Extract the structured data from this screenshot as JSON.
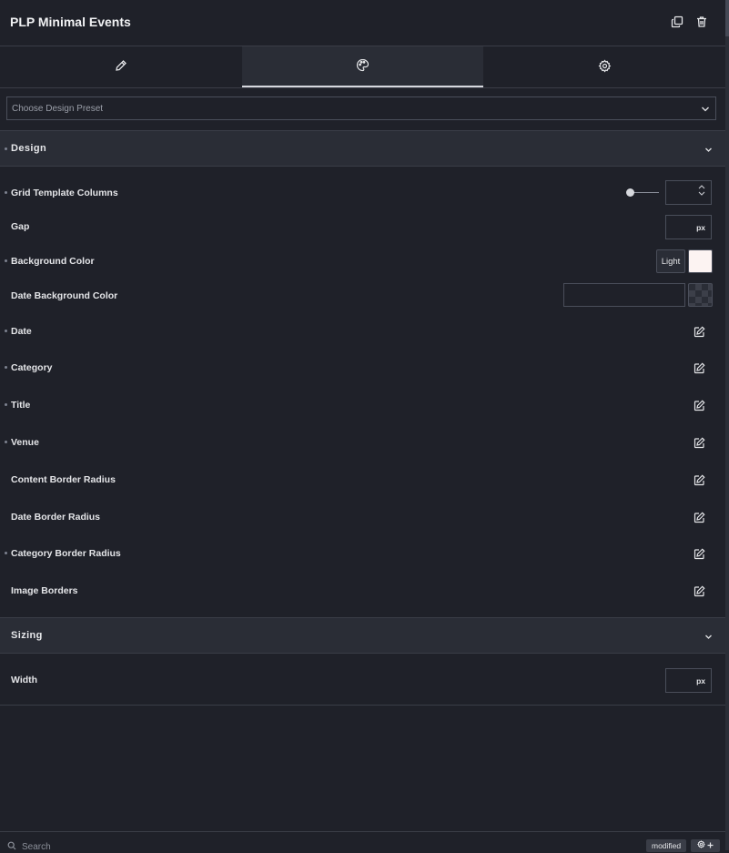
{
  "header": {
    "title": "PLP Minimal Events"
  },
  "tabs": [
    {
      "icon": "pencil-icon"
    },
    {
      "icon": "palette-icon"
    },
    {
      "icon": "gear-icon"
    }
  ],
  "preset": {
    "placeholder": "Choose Design Preset"
  },
  "sections": {
    "design": {
      "title": "Design"
    },
    "sizing": {
      "title": "Sizing"
    }
  },
  "design_rows": {
    "grid_template_columns": "Grid Template Columns",
    "gap": "Gap",
    "gap_unit": "px",
    "background_color": "Background Color",
    "background_mode": "Light",
    "background_swatch": "#fcf3f2",
    "date_background_color": "Date Background Color",
    "date": "Date",
    "category": "Category",
    "title": "Title",
    "venue": "Venue",
    "content_border_radius": "Content Border Radius",
    "date_border_radius": "Date Border Radius",
    "category_border_radius": "Category Border Radius",
    "image_borders": "Image Borders"
  },
  "sizing_rows": {
    "width": "Width",
    "width_unit": "px"
  },
  "footer": {
    "search_placeholder": "Search",
    "modified_label": "modified"
  }
}
